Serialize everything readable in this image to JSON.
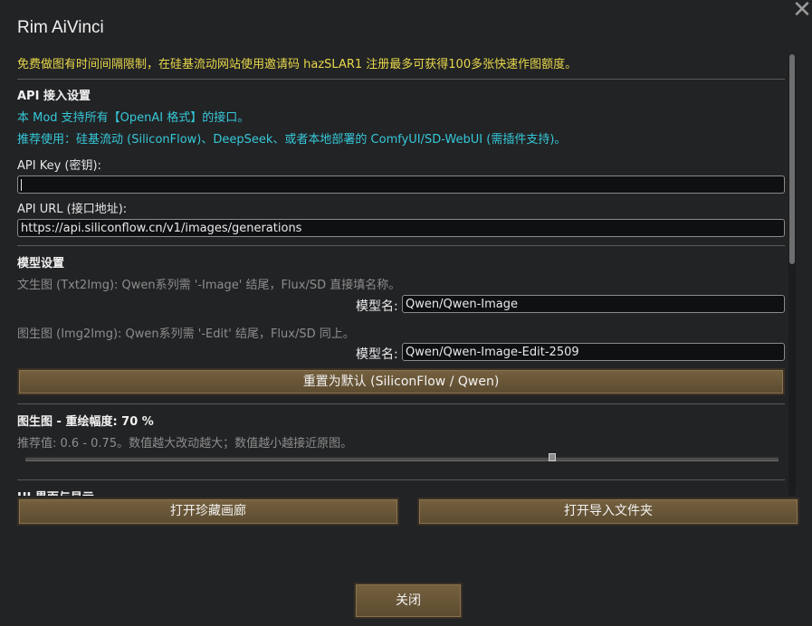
{
  "window": {
    "title": "Rim AiVinci",
    "close_icon": "close-icon",
    "notice": "免费做图有时间间隔限制，在硅基流动网站使用邀请码 hazSLAR1 注册最多可获得100多张快速作图额度。"
  },
  "api": {
    "heading": "API 接入设置",
    "desc1": "本 Mod 支持所有【OpenAI 格式】的接口。",
    "desc2": "推荐使用：硅基流动 (SiliconFlow)、DeepSeek、或者本地部署的 ComfyUI/SD-WebUI (需插件支持)。",
    "key_label": "API Key (密钥):",
    "key_value": "",
    "url_label": "API URL (接口地址):",
    "url_value": "https://api.siliconflow.cn/v1/images/generations"
  },
  "model": {
    "heading": "模型设置",
    "txt2img_hint": "文生图 (Txt2Img): Qwen系列需 '-Image' 结尾，Flux/SD 直接填名称。",
    "txt2img_label": "模型名:",
    "txt2img_value": "Qwen/Qwen-Image",
    "img2img_hint": "图生图 (Img2Img): Qwen系列需 '-Edit' 结尾，Flux/SD 同上。",
    "img2img_label": "模型名:",
    "img2img_value": "Qwen/Qwen-Image-Edit-2509",
    "reset_button": "重置为默认 (SiliconFlow / Qwen)"
  },
  "redraw": {
    "heading": "图生图 - 重绘幅度: 70 %",
    "hint": "推荐值: 0.6 - 0.75。数值越大改动越大；数值越小越接近原图。",
    "value": 0.7
  },
  "ui": {
    "heading": "UI 界面与显示"
  },
  "buttons": {
    "gallery": "打开珍藏画廊",
    "import_folder": "打开导入文件夹",
    "close": "关闭"
  },
  "colors": {
    "notice": "#e8d84a",
    "link_text": "#35c8d8",
    "button": "#6b5838"
  }
}
